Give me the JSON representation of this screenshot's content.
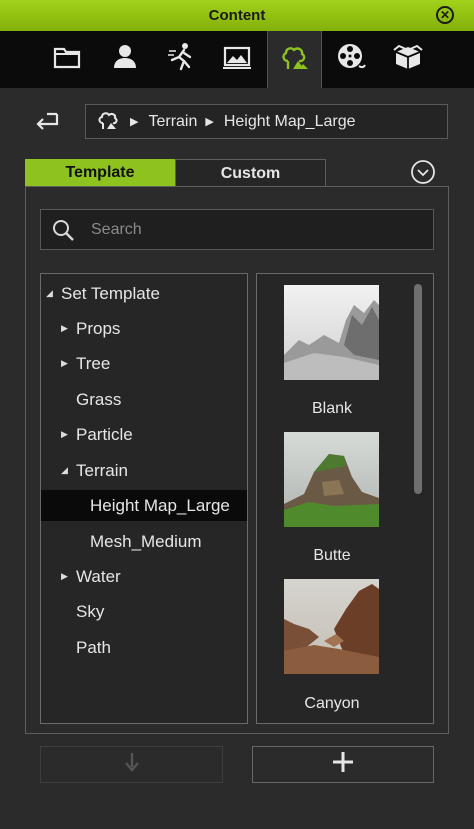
{
  "window": {
    "title": "Content",
    "close_glyph": "⊗"
  },
  "tabs": [
    {
      "icon": "folder-icon"
    },
    {
      "icon": "person-icon"
    },
    {
      "icon": "motion-icon"
    },
    {
      "icon": "scene-icon"
    },
    {
      "icon": "terrain-props-icon",
      "active": true
    },
    {
      "icon": "film-reel-icon"
    },
    {
      "icon": "package-icon"
    }
  ],
  "breadcrumb": {
    "items": [
      "Terrain",
      "Height Map_Large"
    ]
  },
  "content_tabs": {
    "template": "Template",
    "custom": "Custom",
    "active": "Template"
  },
  "search": {
    "placeholder": "Search",
    "value": ""
  },
  "tree": {
    "items": [
      {
        "label": "Set Template",
        "arrow": "expanded",
        "level": 0
      },
      {
        "label": "Props",
        "arrow": "collapsed",
        "level": 1
      },
      {
        "label": "Tree",
        "arrow": "collapsed",
        "level": 1
      },
      {
        "label": "Grass",
        "arrow": "none",
        "level": 1
      },
      {
        "label": "Particle",
        "arrow": "collapsed",
        "level": 1
      },
      {
        "label": "Terrain",
        "arrow": "expanded",
        "level": 1
      },
      {
        "label": "Height Map_Large",
        "arrow": "none",
        "level": 2,
        "selected": true
      },
      {
        "label": "Mesh_Medium",
        "arrow": "none",
        "level": 2
      },
      {
        "label": "Water",
        "arrow": "collapsed",
        "level": 1
      },
      {
        "label": "Sky",
        "arrow": "none",
        "level": 1
      },
      {
        "label": "Path",
        "arrow": "none",
        "level": 1
      }
    ]
  },
  "thumbnails": [
    {
      "label": "Blank"
    },
    {
      "label": "Butte"
    },
    {
      "label": "Canyon"
    }
  ],
  "colors": {
    "accent": "#8dc21f",
    "background": "#2b2b2b",
    "tabstrip": "#0b0b0b"
  }
}
